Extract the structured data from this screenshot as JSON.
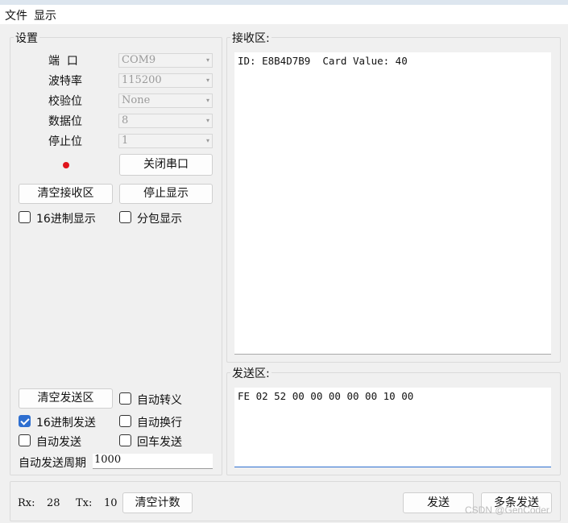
{
  "menu": {
    "items": [
      "文件",
      "显示"
    ]
  },
  "settings": {
    "title": "设置",
    "port": {
      "label": "端  口",
      "value": "COM9"
    },
    "baud": {
      "label": "波特率",
      "value": "115200"
    },
    "parity": {
      "label": "校验位",
      "value": "None"
    },
    "databits": {
      "label": "数据位",
      "value": "8"
    },
    "stopbits": {
      "label": "停止位",
      "value": "1"
    },
    "status_color": "#e0141c",
    "close_port_button": "关闭串口",
    "clear_receive_button": "清空接收区",
    "stop_display_button": "停止显示",
    "hex_display_label": "16进制显示",
    "hex_display_checked": false,
    "packet_display_label": "分包显示",
    "packet_display_checked": false,
    "clear_send_button": "清空发送区",
    "auto_escape_label": "自动转义",
    "auto_escape_checked": false,
    "hex_send_label": "16进制发送",
    "hex_send_checked": true,
    "auto_newline_label": "自动换行",
    "auto_newline_checked": false,
    "auto_send_label": "自动发送",
    "auto_send_checked": false,
    "enter_send_label": "回车发送",
    "enter_send_checked": false,
    "period_label": "自动发送周期",
    "period_value": "1000"
  },
  "receive": {
    "title": "接收区:",
    "content": "ID: E8B4D7B9  Card Value: 40"
  },
  "send": {
    "title": "发送区:",
    "content": "FE 02 52 00 00 00 00 00 10 00"
  },
  "status": {
    "rx_label": "Rx:",
    "rx_value": "28",
    "tx_label": "Tx:",
    "tx_value": "10",
    "clear_count_button": "清空计数",
    "send_button": "发送",
    "multi_send_button": "多条发送"
  },
  "watermark": "CSDN @GenCoder"
}
